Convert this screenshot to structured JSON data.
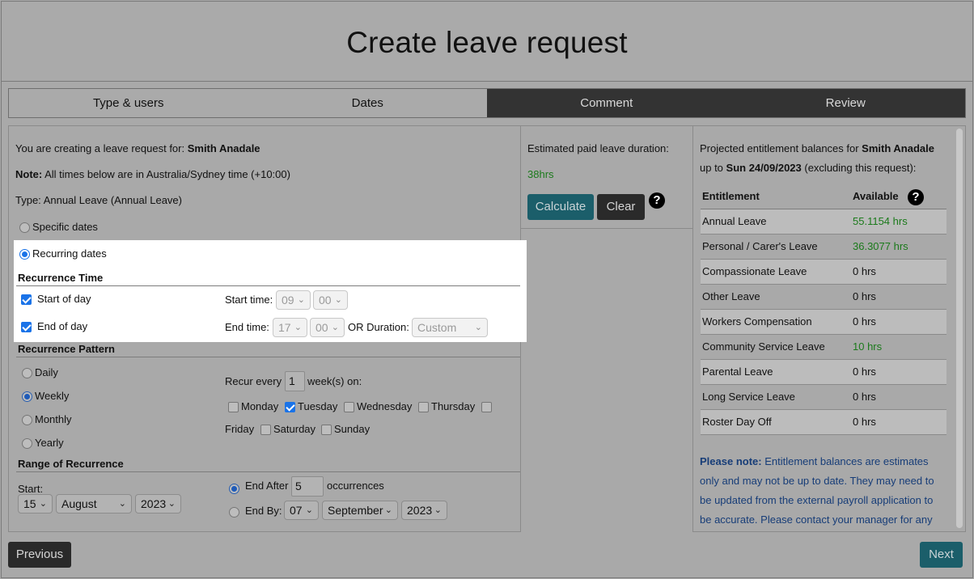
{
  "page": {
    "title": "Create leave request"
  },
  "tabs": [
    "Type & users",
    "Dates",
    "Comment",
    "Review"
  ],
  "intro": {
    "creating_for_label": "You are creating a leave request for: ",
    "creating_for_name": "Smith Anadale",
    "note_label": "Note:",
    "note_text": " All times below are in Australia/Sydney time (+10:00)",
    "type_text": "Type: Annual Leave (Annual Leave)"
  },
  "date_mode": {
    "specific": "Specific dates",
    "recurring": "Recurring dates"
  },
  "recurrence_time": {
    "title": "Recurrence Time",
    "start_of_day": "Start of day",
    "end_of_day": "End of day",
    "start_time_label": "Start time:",
    "start_hour": "09",
    "start_min": "00",
    "end_time_label": "End time:",
    "end_hour": "17",
    "end_min": "00",
    "duration_label": "OR Duration:",
    "duration": "Custom"
  },
  "recurrence_pattern": {
    "title": "Recurrence Pattern",
    "options": [
      "Daily",
      "Weekly",
      "Monthly",
      "Yearly"
    ],
    "recur_every_label": "Recur every",
    "recur_every_value": "1",
    "weeks_on_label": "week(s) on:",
    "days": [
      "Monday",
      "Tuesday",
      "Wednesday",
      "Thursday",
      "Friday",
      "Saturday",
      "Sunday"
    ]
  },
  "range": {
    "title": "Range of Recurrence",
    "start_label": "Start:",
    "start_day": "15",
    "start_month": "August",
    "start_year": "2023",
    "end_after_label": "End After",
    "end_after_value": "5",
    "occurrences_label": "occurrences",
    "end_by_label": "End By:",
    "end_by_day": "07",
    "end_by_month": "September",
    "end_by_year": "2023"
  },
  "estimate": {
    "label": "Estimated paid leave duration:",
    "value": "38hrs",
    "calculate": "Calculate",
    "clear": "Clear",
    "help": "?"
  },
  "projected": {
    "line1": "Projected entitlement balances for ",
    "name": "Smith Anadale",
    "line2": "up to ",
    "date": "Sun 24/09/2023",
    "line2_end": " (excluding this request):",
    "col_entitlement": "Entitlement",
    "col_available": "Available",
    "help": "?",
    "rows": [
      {
        "name": "Annual Leave",
        "value": "55.1154 hrs",
        "positive": true
      },
      {
        "name": "Personal / Carer's Leave",
        "value": "36.3077 hrs",
        "positive": true
      },
      {
        "name": "Compassionate Leave",
        "value": "0 hrs",
        "positive": false
      },
      {
        "name": "Other Leave",
        "value": "0 hrs",
        "positive": false
      },
      {
        "name": "Workers Compensation",
        "value": "0 hrs",
        "positive": false
      },
      {
        "name": "Community Service Leave",
        "value": "10 hrs",
        "positive": true
      },
      {
        "name": "Parental Leave",
        "value": "0 hrs",
        "positive": false
      },
      {
        "name": "Long Service Leave",
        "value": "0 hrs",
        "positive": false
      },
      {
        "name": "Roster Day Off",
        "value": "0 hrs",
        "positive": false
      }
    ],
    "note_label": "Please note:",
    "note_text": " Entitlement balances are estimates only and may not be up to date. They may need to be updated from the external payroll application to be accurate. Please contact your manager for any"
  },
  "nav": {
    "previous": "Previous",
    "next": "Next"
  },
  "colors": {
    "teal": "#1b5e6a",
    "dark": "#333333",
    "positive": "#1b7a1b",
    "note": "#173d78",
    "accent": "#1a73e8"
  }
}
